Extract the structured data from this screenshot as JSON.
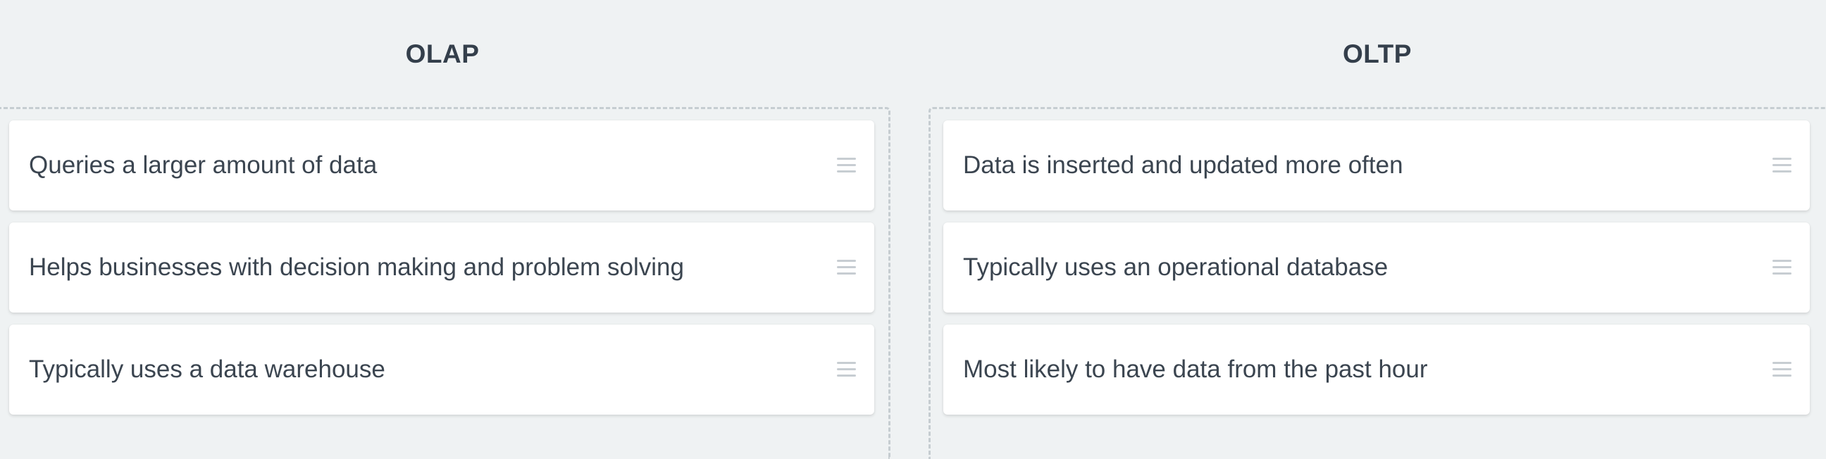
{
  "columns": [
    {
      "title": "OLAP",
      "items": [
        "Queries a larger amount of data",
        "Helps businesses with decision making and problem solving",
        "Typically uses a data warehouse"
      ]
    },
    {
      "title": "OLTP",
      "items": [
        "Data is inserted and updated more often",
        "Typically uses an operational database",
        "Most likely to have data from the past hour"
      ]
    }
  ],
  "icons": {
    "drag_handle": "drag-handle-icon"
  },
  "colors": {
    "background": "#eff2f3",
    "card": "#ffffff",
    "text": "#3b4550",
    "title": "#343f4b",
    "dashed_border": "#c6cdd1",
    "handle": "#c7cdd2"
  }
}
